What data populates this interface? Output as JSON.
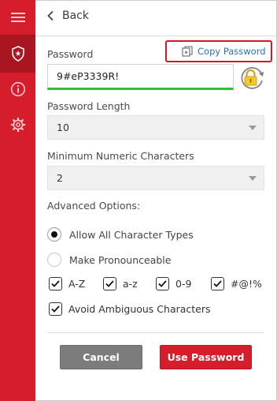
{
  "header": {
    "back_label": "Back"
  },
  "sidebar": {
    "items": [
      "menu",
      "password-generator",
      "info",
      "settings"
    ]
  },
  "password": {
    "label": "Password",
    "value": "9#eP3339R!",
    "copy_label": "Copy Password",
    "strength_color": "#2fc034"
  },
  "length": {
    "label": "Password Length",
    "value": "10"
  },
  "numeric": {
    "label": "Minimum Numeric Characters",
    "value": "2"
  },
  "advanced": {
    "label": "Advanced Options:",
    "radio_all": "Allow All Character Types",
    "radio_pronounce": "Make Pronounceable",
    "selected": "Allow All Character Types",
    "checkboxes": [
      {
        "label": "A-Z",
        "checked": true
      },
      {
        "label": "a-z",
        "checked": true
      },
      {
        "label": "0-9",
        "checked": true
      },
      {
        "label": "#@!%",
        "checked": true
      }
    ],
    "avoid_ambiguous": {
      "label": "Avoid Ambiguous Characters",
      "checked": true
    }
  },
  "buttons": {
    "cancel": "Cancel",
    "use": "Use Password"
  },
  "colors": {
    "brand": "#d51d2c",
    "link": "#2a6fb8",
    "cancel": "#7c7c7c"
  }
}
